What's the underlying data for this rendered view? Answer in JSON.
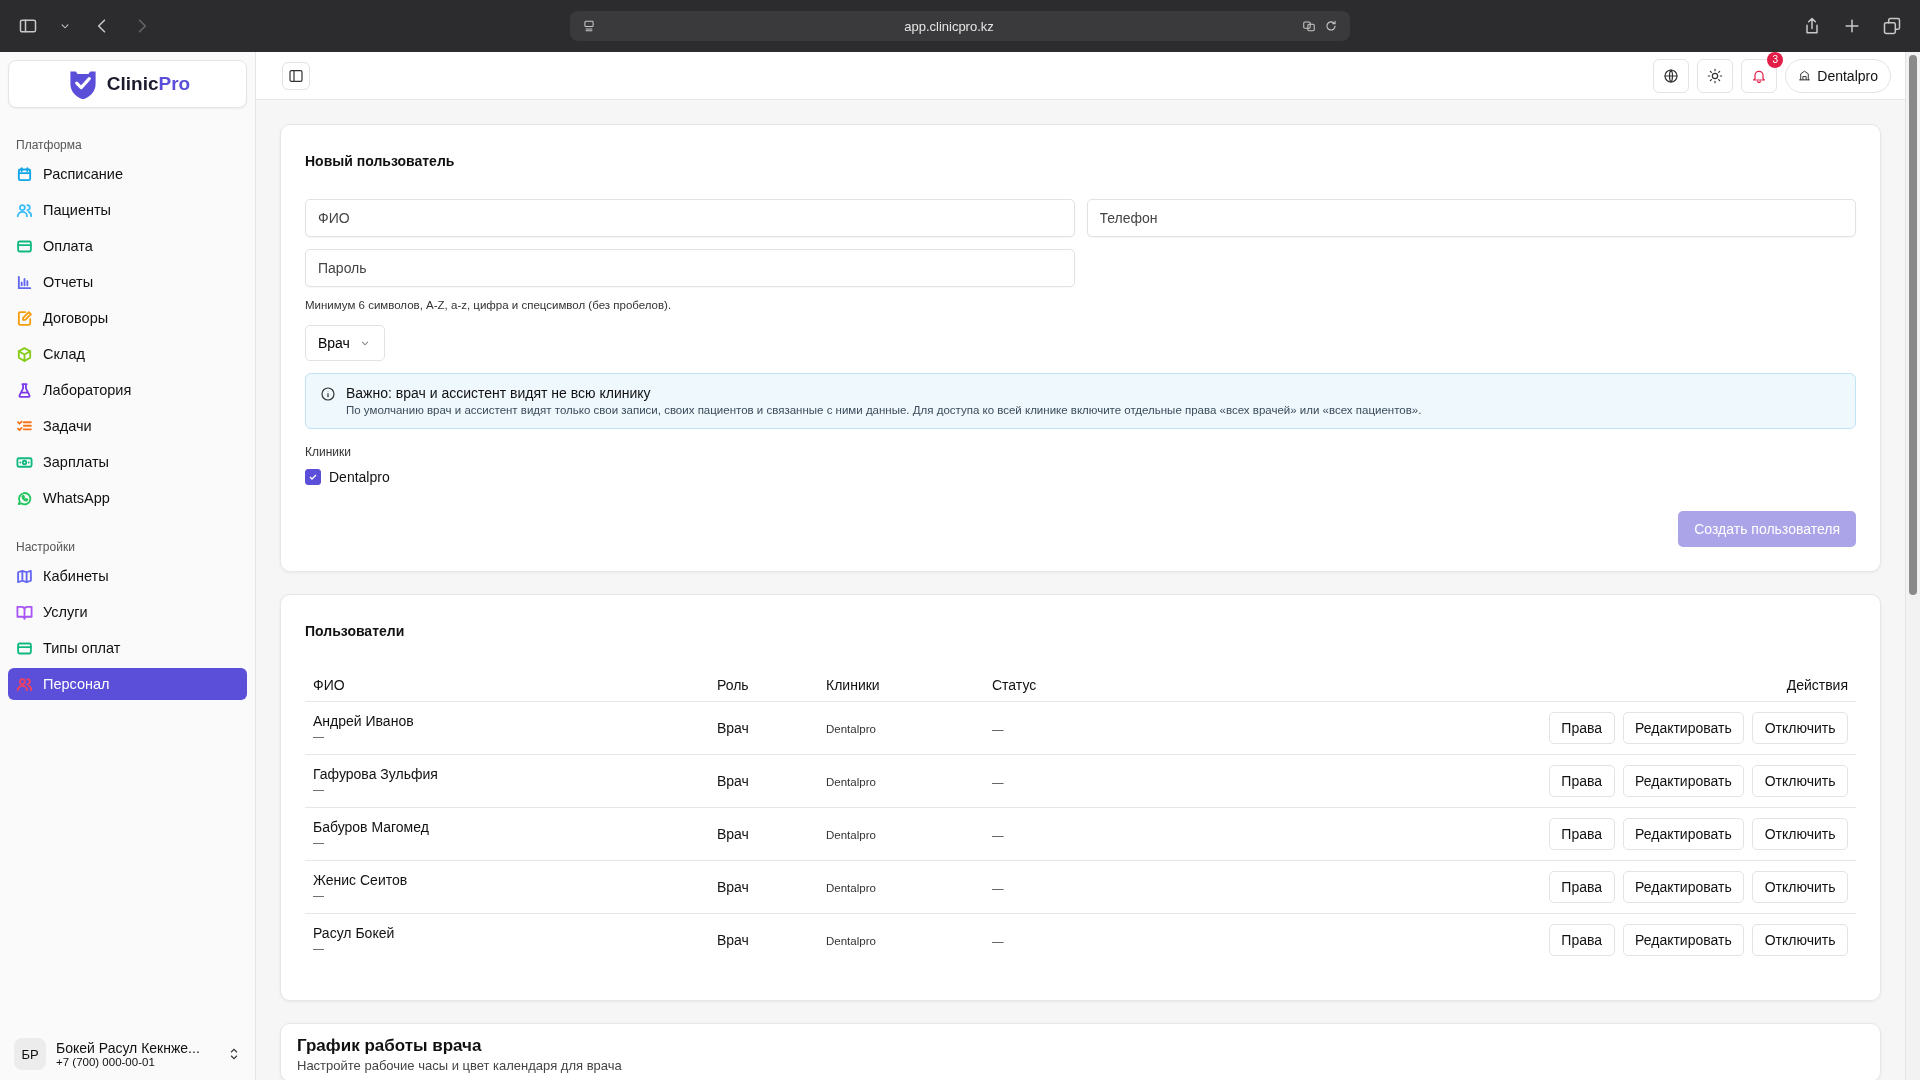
{
  "browser": {
    "url": "app.clinicpro.kz"
  },
  "sidebar": {
    "logo_name": "Clinic",
    "logo_accent": "Pro",
    "sections": [
      {
        "title": "Платформа",
        "items": [
          {
            "label": "Расписание",
            "selected": false,
            "color": "#0ea5e9"
          },
          {
            "label": "Пациенты",
            "selected": false,
            "color": "#38bdf8"
          },
          {
            "label": "Оплата",
            "selected": false,
            "color": "#10b981"
          },
          {
            "label": "Отчеты",
            "selected": false,
            "color": "#6366f1"
          },
          {
            "label": "Договоры",
            "selected": false,
            "color": "#f59e0b"
          },
          {
            "label": "Склад",
            "selected": false,
            "color": "#84cc16"
          },
          {
            "label": "Лаборатория",
            "selected": false,
            "color": "#7c3aed"
          },
          {
            "label": "Задачи",
            "selected": false,
            "color": "#f97316"
          },
          {
            "label": "Зарплаты",
            "selected": false,
            "color": "#10b981"
          },
          {
            "label": "WhatsApp",
            "selected": false,
            "color": "#22c55e"
          }
        ]
      },
      {
        "title": "Настройки",
        "items": [
          {
            "label": "Кабинеты",
            "selected": false,
            "color": "#6366f1"
          },
          {
            "label": "Услуги",
            "selected": false,
            "color": "#a855f7"
          },
          {
            "label": "Типы оплат",
            "selected": false,
            "color": "#10b981"
          },
          {
            "label": "Персонал",
            "selected": true,
            "color": "#f43f5e"
          }
        ]
      }
    ],
    "user": {
      "initials": "БР",
      "name": "Бокей Расул Кекнже...",
      "phone": "+7 (700) 000-00-01"
    }
  },
  "header": {
    "notifications": "3",
    "clinic": "Dentalpro"
  },
  "new_user": {
    "title": "Новый пользователь",
    "fields": [
      {
        "placeholder": "ФИО"
      },
      {
        "placeholder": "Телефон"
      },
      {
        "placeholder": "Пароль"
      }
    ],
    "password_hint": "Минимум 6 символов, A-Z, a-z, цифра и спецсимвол (без пробелов).",
    "role": "Врач",
    "notice": {
      "title": "Важно: врач и ассистент видят не всю клинику",
      "text": "По умолчанию врач и ассистент видят только свои записи, своих пациентов и связанные с ними данные. Для доступа ко всей клинике включите отдельные права «всех врачей» или «всех пациентов»."
    },
    "clinics_label": "Клиники",
    "clinics": [
      {
        "label": "Dentalpro",
        "checked": true
      }
    ],
    "submit": {
      "label": "Создать пользователя",
      "disabled": true
    }
  },
  "users": {
    "title": "Пользователи",
    "columns": [
      "ФИО",
      "Роль",
      "Клиники",
      "Статус",
      "Действия"
    ],
    "rows": [
      {
        "name": "Андрей Иванов",
        "subtitle": "—",
        "role": "Врач",
        "clinic": "Dentalpro",
        "status": "—",
        "actions": [
          "Права",
          "Редактировать",
          "Отключить"
        ]
      },
      {
        "name": "Гафурова Зульфия",
        "subtitle": "—",
        "role": "Врач",
        "clinic": "Dentalpro",
        "status": "—",
        "actions": [
          "Права",
          "Редактировать",
          "Отключить"
        ]
      },
      {
        "name": "Бабуров Магомед",
        "subtitle": "—",
        "role": "Врач",
        "clinic": "Dentalpro",
        "status": "—",
        "actions": [
          "Права",
          "Редактировать",
          "Отключить"
        ]
      },
      {
        "name": "Женис Сеитов",
        "subtitle": "—",
        "role": "Врач",
        "clinic": "Dentalpro",
        "status": "—",
        "actions": [
          "Права",
          "Редактировать",
          "Отключить"
        ]
      },
      {
        "name": "Расул Бокей",
        "subtitle": "—",
        "role": "Врач",
        "clinic": "Dentalpro",
        "status": "—",
        "actions": [
          "Права",
          "Редактировать",
          "Отключить"
        ]
      }
    ]
  },
  "schedule": {
    "title": "График работы врача",
    "subtitle": "Настройте рабочие часы и цвет календаря для врача"
  }
}
